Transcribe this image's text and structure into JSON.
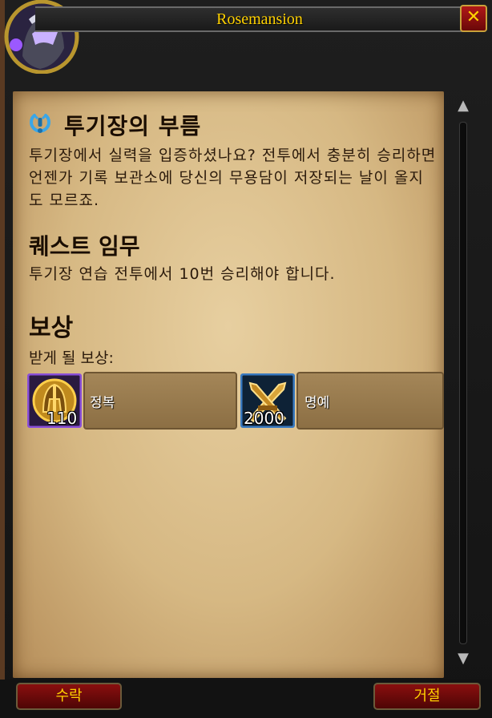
{
  "window": {
    "title": "Rosemansion",
    "close_glyph": "✕"
  },
  "quest": {
    "title": "투기장의 부름",
    "description": "투기장에서 실력을 입증하셨나요? 전투에서 충분히 승리하면 언젠가 기록 보관소에 당신의 무용담이 저장되는 날이 올지도 모르죠.",
    "objectives_heading": "퀘스트 임무",
    "objective_text": "투기장 연습 전투에서 10번 승리해야 합니다.",
    "rewards_heading": "보상",
    "rewards_subheading": "받게 될 보상:",
    "rewards": [
      {
        "icon": "conquest-helm-icon",
        "count": "110",
        "name": "정복"
      },
      {
        "icon": "honor-swords-icon",
        "count": "2000",
        "name": "명예"
      }
    ]
  },
  "buttons": {
    "accept": "수락",
    "decline": "거절"
  },
  "colors": {
    "title_gold": "#ffd100",
    "button_red": "#8a0f0f",
    "parchment": "#e7cfa0"
  }
}
